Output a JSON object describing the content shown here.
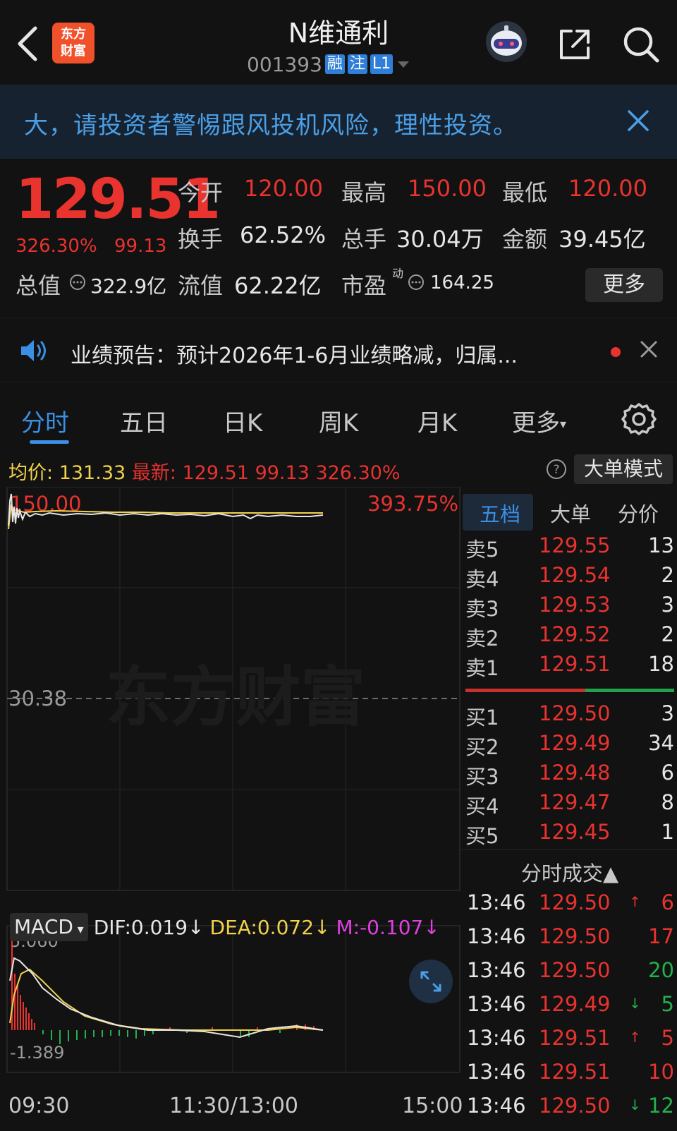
{
  "header": {
    "logo_line1": "东方",
    "logo_line2": "财富",
    "stock_name": "N维通利",
    "stock_code": "001393",
    "tags": [
      "融",
      "注",
      "L1"
    ]
  },
  "banner": {
    "text": "大，请投资者警惕跟风投机风险，理性投资。"
  },
  "quote": {
    "price": "129.51",
    "pct_change": "326.30%",
    "change": "99.13",
    "open_label": "今开",
    "open": "120.00",
    "high_label": "最高",
    "high": "150.00",
    "low_label": "最低",
    "low": "120.00",
    "turnover_label": "换手",
    "turnover": "62.52%",
    "volume_label": "总手",
    "volume": "30.04万",
    "amount_label": "金额",
    "amount": "39.45亿",
    "total_value_label": "总值",
    "total_value": "322.9亿",
    "float_value_label": "流值",
    "float_value": "62.22亿",
    "pe_label": "市盈",
    "pe_sup": "动",
    "pe": "164.25",
    "more_label": "更多"
  },
  "announcement": {
    "text": "业绩预告：预计2026年1-6月业绩略减，归属..."
  },
  "tabs": [
    "分时",
    "五日",
    "日K",
    "周K",
    "月K",
    "更多"
  ],
  "info_line": {
    "avg_label": "均价:",
    "avg": "131.33",
    "latest_label": "最新:",
    "latest": "129.51",
    "change": "99.13",
    "pct": "326.30%",
    "big_order_mode": "大单模式"
  },
  "chart": {
    "top_price": "150.00",
    "top_pct": "393.75%",
    "mid_price": "30.38",
    "watermark": "东方财富",
    "x_labels": [
      "09:30",
      "11:30/13:00",
      "15:00"
    ],
    "colors": {
      "price_line": "#e6e6e6",
      "avg_line": "#f2d24b",
      "up": "#e8332f",
      "down": "#22b14c"
    }
  },
  "macd": {
    "name": "MACD",
    "dif": "DIF:0.019↓",
    "dea": "DEA:0.072↓",
    "m": "M:-0.107↓",
    "top": "5.060",
    "bottom": "-1.389"
  },
  "order_book": {
    "tabs": [
      "五档",
      "大单",
      "分价"
    ],
    "sells": [
      {
        "label": "卖5",
        "price": "129.55",
        "vol": "13"
      },
      {
        "label": "卖4",
        "price": "129.54",
        "vol": "2"
      },
      {
        "label": "卖3",
        "price": "129.53",
        "vol": "3"
      },
      {
        "label": "卖2",
        "price": "129.52",
        "vol": "2"
      },
      {
        "label": "卖1",
        "price": "129.51",
        "vol": "18"
      }
    ],
    "buys": [
      {
        "label": "买1",
        "price": "129.50",
        "vol": "3"
      },
      {
        "label": "买2",
        "price": "129.49",
        "vol": "34"
      },
      {
        "label": "买3",
        "price": "129.48",
        "vol": "6"
      },
      {
        "label": "买4",
        "price": "129.47",
        "vol": "8"
      },
      {
        "label": "买5",
        "price": "129.45",
        "vol": "1"
      }
    ]
  },
  "trades": {
    "title": "分时成交▲",
    "rows": [
      {
        "time": "13:46",
        "price": "129.50",
        "arrow": "↑",
        "arrow_color": "red",
        "vol": "6",
        "vol_color": "red"
      },
      {
        "time": "13:46",
        "price": "129.50",
        "arrow": "",
        "arrow_color": "",
        "vol": "17",
        "vol_color": "red"
      },
      {
        "time": "13:46",
        "price": "129.50",
        "arrow": "",
        "arrow_color": "",
        "vol": "20",
        "vol_color": "green"
      },
      {
        "time": "13:46",
        "price": "129.49",
        "arrow": "↓",
        "arrow_color": "green",
        "vol": "5",
        "vol_color": "green"
      },
      {
        "time": "13:46",
        "price": "129.51",
        "arrow": "↑",
        "arrow_color": "red",
        "vol": "5",
        "vol_color": "red"
      },
      {
        "time": "13:46",
        "price": "129.51",
        "arrow": "",
        "arrow_color": "",
        "vol": "10",
        "vol_color": "red"
      },
      {
        "time": "13:46",
        "price": "129.50",
        "arrow": "↓",
        "arrow_color": "green",
        "vol": "12",
        "vol_color": "green"
      }
    ]
  }
}
